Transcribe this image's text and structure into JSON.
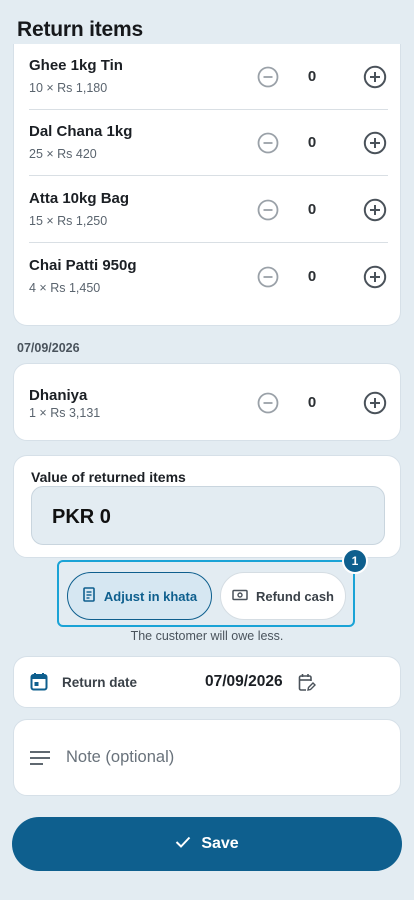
{
  "header": {
    "title": "Return items"
  },
  "items": [
    {
      "name": "Ghee 1kg Tin",
      "price": "10 × Rs 1,180",
      "qty": "0"
    },
    {
      "name": "Dal Chana 1kg",
      "price": "25 × Rs 420",
      "qty": "0"
    },
    {
      "name": "Atta 10kg Bag",
      "price": "15 × Rs 1,250",
      "qty": "0"
    },
    {
      "name": "Chai Patti 950g",
      "price": "4 × Rs 1,450",
      "qty": "0"
    }
  ],
  "group_date": "07/09/2026",
  "group_items": [
    {
      "name": "Dhaniya",
      "price": "1 × Rs 3,131",
      "qty": "0"
    }
  ],
  "value": {
    "title": "Value of returned items",
    "amount": "PKR 0"
  },
  "refund_options": {
    "adjust_label": "Adjust in khata",
    "refund_label": "Refund cash",
    "selected": "adjust",
    "badge": "1",
    "hint": "The customer will owe less."
  },
  "return_date": {
    "label": "Return date",
    "value": "07/09/2026"
  },
  "note": {
    "placeholder": "Note (optional)",
    "value": ""
  },
  "save": {
    "label": "Save"
  },
  "colors": {
    "primary": "#0e5f8e",
    "background": "#e3ecf2",
    "focus": "#1aa3d6"
  },
  "icons": {
    "minus": "minus-circle-icon",
    "plus": "plus-circle-icon",
    "khata": "receipt-icon",
    "cash": "cash-icon",
    "calendar": "calendar-icon",
    "edit_calendar": "edit-calendar-icon",
    "note": "notes-icon",
    "save": "check-icon"
  }
}
